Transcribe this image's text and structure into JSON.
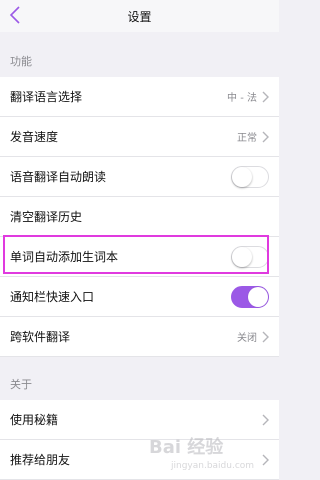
{
  "header": {
    "title": "设置"
  },
  "sections": [
    {
      "title": "功能",
      "rows": [
        {
          "label": "翻译语言选择",
          "value": "中 - 法"
        },
        {
          "label": "发音速度",
          "value": "正常"
        },
        {
          "label": "语音翻译自动朗读",
          "toggle": "off"
        },
        {
          "label": "清空翻译历史"
        },
        {
          "label": "单词自动添加生词本",
          "toggle": "off"
        },
        {
          "label": "通知栏快速入口",
          "toggle": "on"
        },
        {
          "label": "跨软件翻译",
          "value": "关闭"
        }
      ]
    },
    {
      "title": "关于",
      "rows": [
        {
          "label": "使用秘籍"
        },
        {
          "label": "推荐给朋友"
        }
      ]
    }
  ],
  "watermark": {
    "text": "Bai 经验",
    "subtext": "jingyan.baidu.com"
  },
  "colors": {
    "accent": "#9b59e6",
    "highlight": "#e03adf",
    "background": "#f1f0f5"
  }
}
